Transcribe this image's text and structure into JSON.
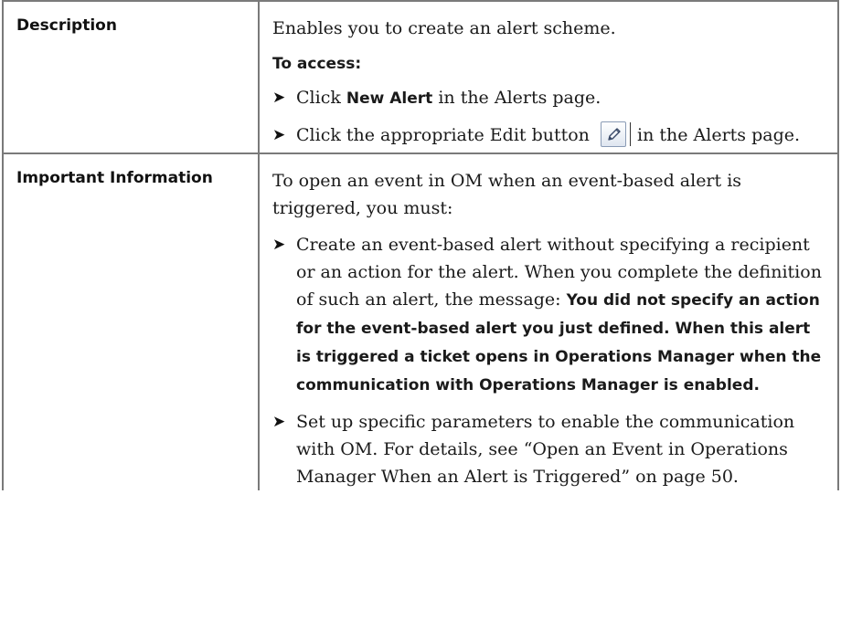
{
  "rows": {
    "description": {
      "label": "Description",
      "text": "Enables you to create an alert scheme.",
      "access_heading": "To access:",
      "bullets": {
        "b1_pre": "Click ",
        "b1_bold": "New Alert",
        "b1_post": " in the Alerts page.",
        "b2_pre": "Click the appropriate Edit button",
        "b2_icon": "pencil-icon",
        "b2_post": "in the Alerts page."
      }
    },
    "important": {
      "label": "Important Information",
      "intro": "To open an event in OM when an event-based alert is triggered, you must:",
      "bullets": {
        "b1_pre": "Create an event-based alert without specifying a recipient or an action for the alert. When you complete the definition of such an alert, the message: ",
        "b1_bold": "You did not specify an action for the event-based alert you just defined. When this alert is triggered a ticket opens in Operations Manager when the communication with Operations Manager is enabled.",
        "b2": "Set up specific parameters to enable the communication with OM. For details, see “Open an Event in Operations Manager When an Alert is Triggered” on page 50."
      }
    }
  },
  "bullet_glyph": "➤"
}
